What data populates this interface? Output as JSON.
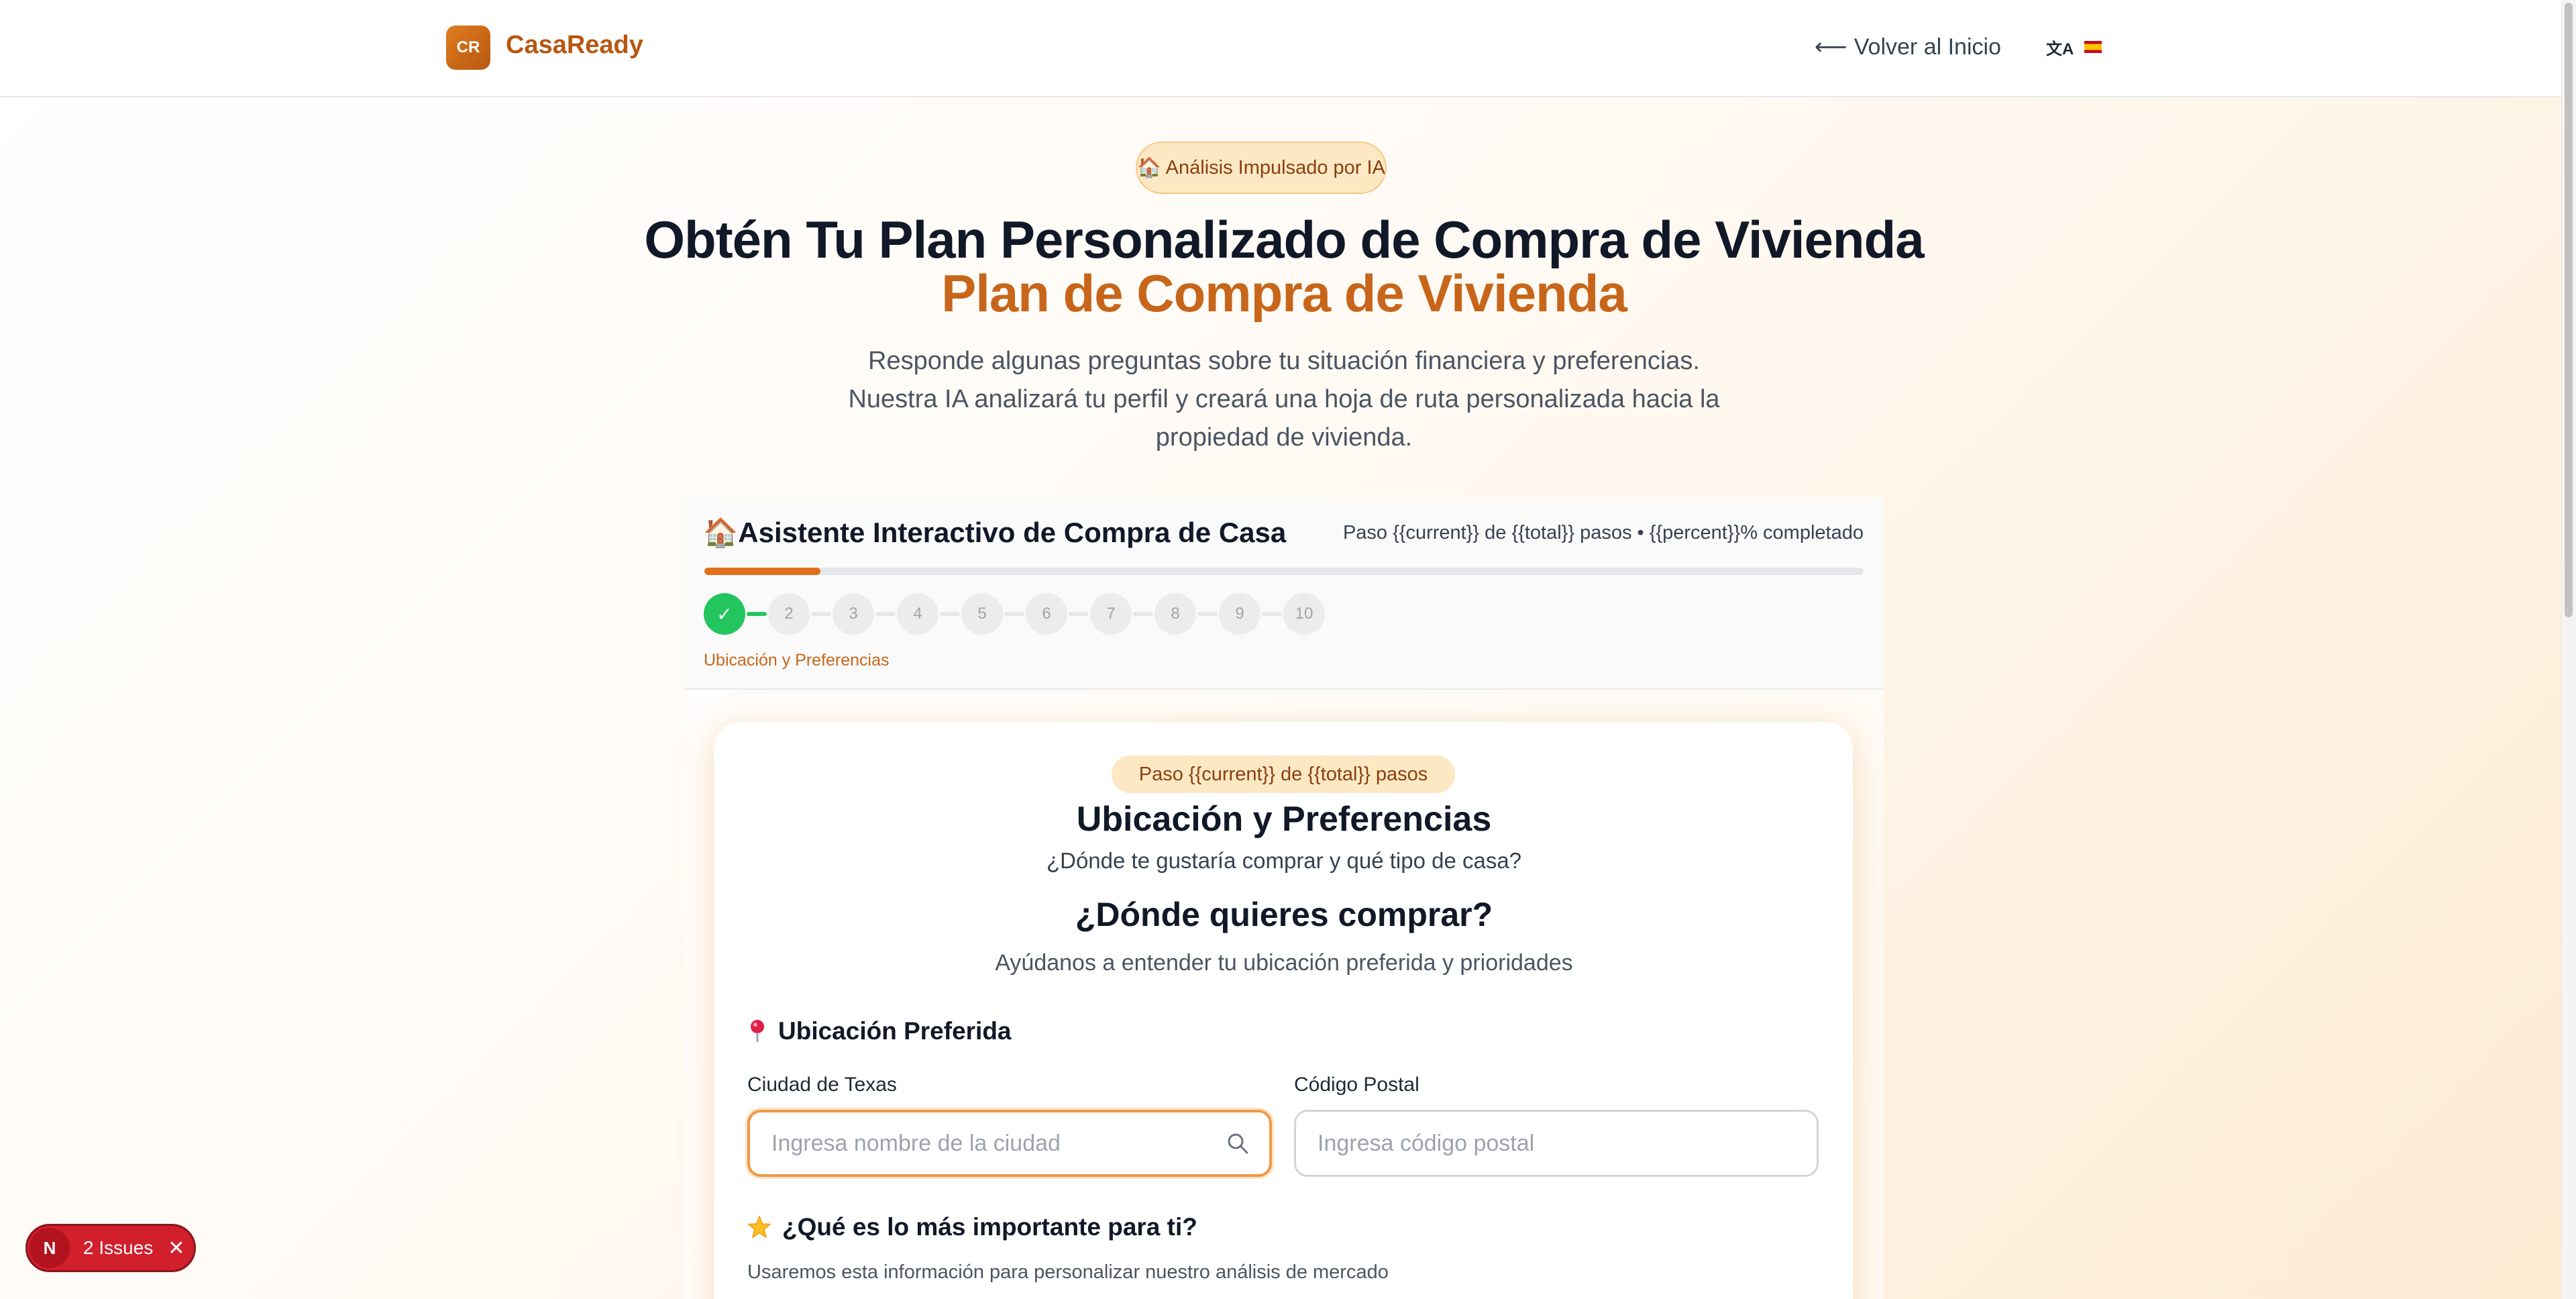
{
  "header": {
    "logo_initials": "CR",
    "brand": "CasaReady",
    "back_label": "Volver al Inicio",
    "translate_icon": "文A"
  },
  "hero": {
    "badge": "🏠 Análisis Impulsado por IA",
    "title_line1": "Obtén Tu Plan Personalizado de Compra de Vivienda",
    "title_line2": "Plan de Compra de Vivienda",
    "description": "Responde algunas preguntas sobre tu situación financiera y preferencias. Nuestra IA analizará tu perfil y creará una hoja de ruta personalizada hacia la propiedad de vivienda."
  },
  "wizard": {
    "title": "🏠Asistente Interactivo de Compra de Casa",
    "progress_text": "Paso {{current}} de {{total}} pasos • {{percent}}% completado",
    "progress_fraction": 0.1,
    "steps": [
      "✓",
      "2",
      "3",
      "4",
      "5",
      "6",
      "7",
      "8",
      "9",
      "10"
    ],
    "current_step_label": "Ubicación y Preferencias"
  },
  "card": {
    "step_pill": "Paso {{current}} de {{total}} pasos",
    "title": "Ubicación y Preferencias",
    "subtitle": "¿Dónde te gustaría comprar y qué tipo de casa?",
    "section_title": "¿Dónde quieres comprar?",
    "section_sub": "Ayúdanos a entender tu ubicación preferida y prioridades",
    "location_heading": "Ubicación Preferida",
    "city_label": "Ciudad de Texas",
    "city_placeholder": "Ingresa nombre de la ciudad",
    "zip_label": "Código Postal",
    "zip_placeholder": "Ingresa código postal",
    "priority_heading": "¿Qué es lo más importante para ti?",
    "priority_sub": "Usaremos esta información para personalizar nuestro análisis de mercado"
  },
  "issues": {
    "logo": "N",
    "label": "2 Issues",
    "close": "✕"
  },
  "colors": {
    "accent": "#e0701a",
    "brand": "#b75711",
    "success": "#22c55e",
    "error": "#d11f2c"
  }
}
